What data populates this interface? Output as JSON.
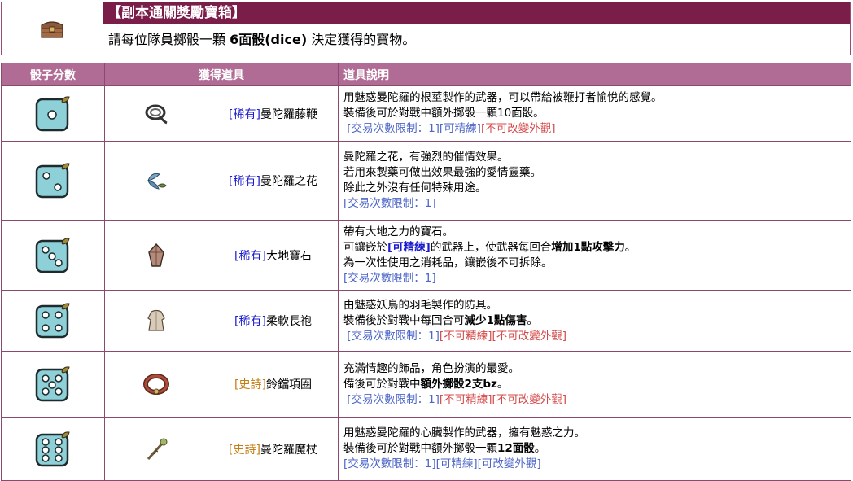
{
  "header": {
    "title": "【副本通關獎勵寶箱】",
    "subtitle_pre": "請每位隊員擲骰一顆 ",
    "subtitle_bold": "6面骰(dice)",
    "subtitle_post": " 決定獲得的寶物。"
  },
  "columns": {
    "dice": "骰子分數",
    "item": "獲得道具",
    "desc": "道具說明"
  },
  "rows": [
    {
      "dice": 1,
      "icon": "whip-icon",
      "tag": "[稀有]",
      "name": "曼陀羅藤鞭",
      "line1": "用魅惑曼陀羅的根莖製作的武器，可以帶給被鞭打者愉悅的感覺。",
      "line2": "裝備後可於對戰中額外擲骰一顆10面骰。",
      "trade": "[交易次數限制：1][可精練]",
      "trade_red": "[不可改變外觀]"
    },
    {
      "dice": 2,
      "icon": "flower-icon",
      "tag": "[稀有]",
      "name": "曼陀羅之花",
      "line1": "曼陀羅之花，有強烈的催情效果。",
      "line2": "若用來製藥可做出效果最強的愛情靈藥。",
      "line3": "除此之外沒有任何特殊用途。",
      "trade": "[交易次數限制：1]"
    },
    {
      "dice": 3,
      "icon": "gem-icon",
      "tag": "[稀有]",
      "name": "大地寶石",
      "line1": "帶有大地之力的寶石。",
      "line2_pre": "可鑲嵌於",
      "line2_blue": "[可精練]",
      "line2_mid": "的武器上，使武器每回合",
      "line2_bold": "增加1點攻擊力",
      "line2_end": "。",
      "line3": "為一次性使用之消耗品，鑲嵌後不可拆除。",
      "trade": "[交易次數限制：1]"
    },
    {
      "dice": 4,
      "icon": "robe-icon",
      "tag": "[稀有]",
      "name": "柔軟長袍",
      "line1": "由魅惑妖鳥的羽毛製作的防具。",
      "line2_pre": "裝備後於對戰中每回合可",
      "line2_bold": "減少1點傷害",
      "line2_end": "。",
      "trade": "[交易次數限制：1]",
      "trade_red": "[不可精練][不可改變外觀]"
    },
    {
      "dice": 5,
      "icon": "collar-icon",
      "tag": "[史詩]",
      "name": "鈴鐺項圈",
      "line1": "充滿情趣的飾品，角色扮演的最愛。",
      "line2_pre": "備後可於對戰中",
      "line2_bold": "額外擲骰2支bz",
      "line2_end": "。",
      "trade": "[交易次數限制：1]",
      "trade_red": "[不可精練][不可改變外觀]"
    },
    {
      "dice": 6,
      "icon": "staff-icon",
      "tag": "[史詩]",
      "name": "曼陀羅魔杖",
      "line1": "用魅惑曼陀羅的心臟製作的武器，擁有魅惑之力。",
      "line2_pre": "裝備後可於對戰中額外擲骰一顆",
      "line2_bold": "12面骰",
      "line2_end": "。",
      "trade": "[交易次數限制：1][可精練][可改變外觀]"
    }
  ],
  "colors": {
    "title_bg": "#7a1d49",
    "header_bg": "#b06c94",
    "rare": "#1c1ccf",
    "epic": "#c67c12",
    "trade": "#4d66c7",
    "restricted": "#d44a4a",
    "dice": "#8ed0d8"
  }
}
